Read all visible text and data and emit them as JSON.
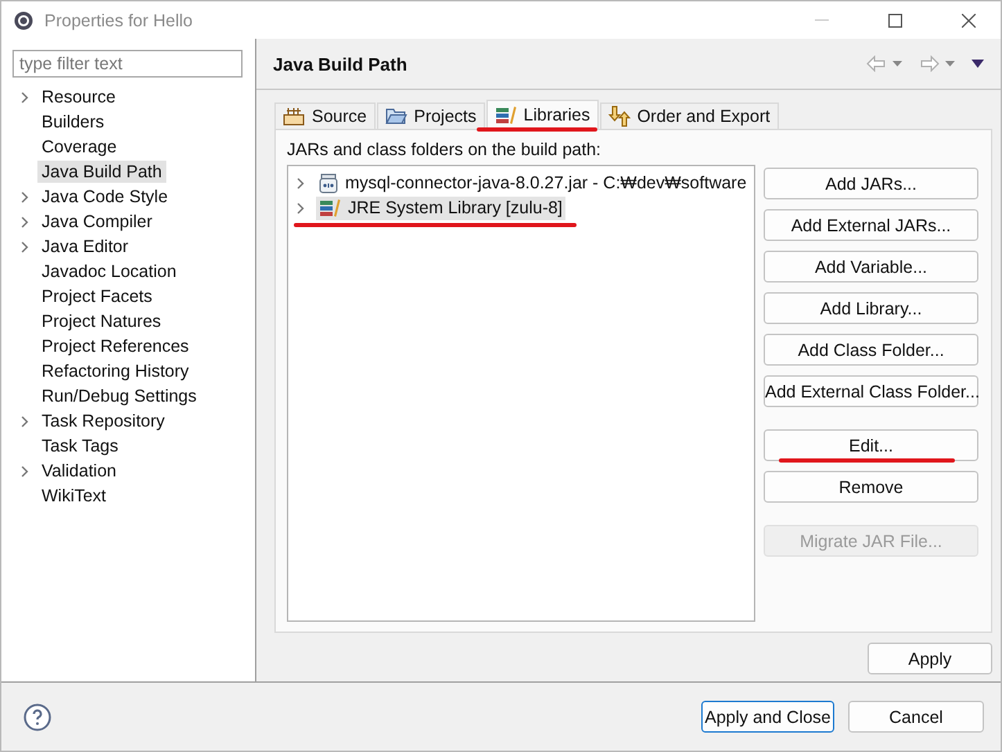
{
  "window": {
    "title": "Properties for Hello"
  },
  "filter": {
    "placeholder": "type filter text"
  },
  "sidebar": {
    "items": [
      {
        "label": "Resource",
        "expandable": true,
        "selected": false
      },
      {
        "label": "Builders",
        "expandable": false,
        "selected": false
      },
      {
        "label": "Coverage",
        "expandable": false,
        "selected": false
      },
      {
        "label": "Java Build Path",
        "expandable": false,
        "selected": true
      },
      {
        "label": "Java Code Style",
        "expandable": true,
        "selected": false
      },
      {
        "label": "Java Compiler",
        "expandable": true,
        "selected": false
      },
      {
        "label": "Java Editor",
        "expandable": true,
        "selected": false
      },
      {
        "label": "Javadoc Location",
        "expandable": false,
        "selected": false
      },
      {
        "label": "Project Facets",
        "expandable": false,
        "selected": false
      },
      {
        "label": "Project Natures",
        "expandable": false,
        "selected": false
      },
      {
        "label": "Project References",
        "expandable": false,
        "selected": false
      },
      {
        "label": "Refactoring History",
        "expandable": false,
        "selected": false
      },
      {
        "label": "Run/Debug Settings",
        "expandable": false,
        "selected": false
      },
      {
        "label": "Task Repository",
        "expandable": true,
        "selected": false
      },
      {
        "label": "Task Tags",
        "expandable": false,
        "selected": false
      },
      {
        "label": "Validation",
        "expandable": true,
        "selected": false
      },
      {
        "label": "WikiText",
        "expandable": false,
        "selected": false
      }
    ]
  },
  "page": {
    "title": "Java Build Path"
  },
  "tabs": [
    {
      "label": "Source",
      "kind": "source",
      "selected": false,
      "underlined": false
    },
    {
      "label": "Projects",
      "kind": "projects",
      "selected": false,
      "underlined": false
    },
    {
      "label": "Libraries",
      "kind": "libraries",
      "selected": true,
      "underlined": true
    },
    {
      "label": "Order and Export",
      "kind": "order",
      "selected": false,
      "underlined": false
    }
  ],
  "build_path": {
    "label": "JARs and class folders on the build path:",
    "entries": [
      {
        "label": "mysql-connector-java-8.0.27.jar - C:₩dev₩software",
        "kind": "jar",
        "selected": false,
        "underlined": false
      },
      {
        "label": "JRE System Library [zulu-8]",
        "kind": "library",
        "selected": true,
        "underlined": true
      }
    ]
  },
  "button_groups": [
    [
      {
        "label": "Add JARs...",
        "disabled": false,
        "underlined": false
      },
      {
        "label": "Add External JARs...",
        "disabled": false,
        "underlined": false
      },
      {
        "label": "Add Variable...",
        "disabled": false,
        "underlined": false
      },
      {
        "label": "Add Library...",
        "disabled": false,
        "underlined": false
      },
      {
        "label": "Add Class Folder...",
        "disabled": false,
        "underlined": false
      },
      {
        "label": "Add External Class Folder...",
        "disabled": false,
        "underlined": false
      }
    ],
    [
      {
        "label": "Edit...",
        "disabled": false,
        "underlined": true
      },
      {
        "label": "Remove",
        "disabled": false,
        "underlined": false
      }
    ],
    [
      {
        "label": "Migrate JAR File...",
        "disabled": true,
        "underlined": false
      }
    ]
  ],
  "apply_button": {
    "label": "Apply"
  },
  "footer": {
    "buttons": [
      {
        "label": "Apply and Close",
        "default": true
      },
      {
        "label": "Cancel",
        "default": false
      }
    ]
  }
}
